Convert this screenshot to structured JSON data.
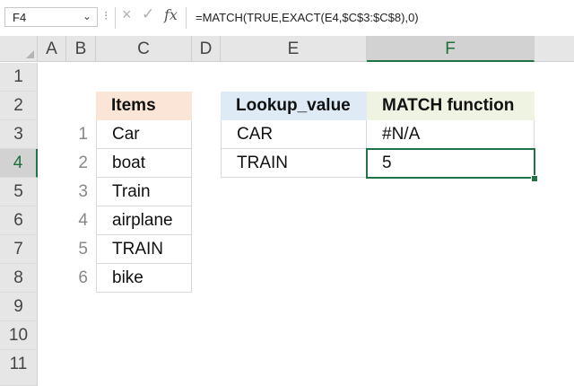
{
  "formula_bar": {
    "name_box": "F4",
    "name_box_arrow_icon": "chevron-down-icon",
    "dots": "⁝",
    "cancel_icon": "×",
    "enter_icon": "✓",
    "fx_label": "fx",
    "formula": "=MATCH(TRUE,EXACT(E4,$C$3:$C$8),0)"
  },
  "columns": [
    "A",
    "B",
    "C",
    "D",
    "E",
    "F"
  ],
  "rows": [
    "1",
    "2",
    "3",
    "4",
    "5",
    "6",
    "7",
    "8",
    "9",
    "10",
    "11"
  ],
  "selected_cell": "F4",
  "items_table": {
    "header": "Items",
    "numbers": [
      "1",
      "2",
      "3",
      "4",
      "5",
      "6"
    ],
    "values": [
      "Car",
      "boat",
      "Train",
      "airplane",
      "TRAIN",
      "bike"
    ]
  },
  "match_table": {
    "header_lookup": "Lookup_value",
    "header_match": "MATCH function",
    "rows": [
      {
        "lookup": "CAR",
        "result": "#N/A"
      },
      {
        "lookup": "TRAIN",
        "result": "5"
      }
    ]
  },
  "colors": {
    "items_header": "#fbe5d6",
    "lookup_header": "#deebf7",
    "match_header": "#eef3e2",
    "selection": "#217346"
  }
}
